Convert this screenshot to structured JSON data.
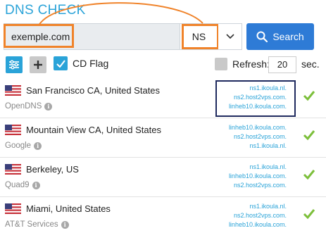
{
  "title": "DNS CHECK",
  "search": {
    "domain_value": "exemple.com",
    "record_type": "NS",
    "button_label": "Search"
  },
  "toolbar": {
    "cd_flag_label": "CD Flag",
    "cd_flag_checked": true,
    "refresh_label": "Refresh:",
    "refresh_checked": false,
    "refresh_value": "20",
    "refresh_unit": "sec."
  },
  "results": [
    {
      "location": "San Francisco CA, United States",
      "provider": "OpenDNS",
      "records": [
        "ns1.ikoula.nl.",
        "ns2.host2vps.com.",
        "linheb10.ikoula.com."
      ],
      "status": "ok"
    },
    {
      "location": "Mountain View CA, United States",
      "provider": "Google",
      "records": [
        "linheb10.ikoula.com.",
        "ns2.host2vps.com.",
        "ns1.ikoula.nl."
      ],
      "status": "ok"
    },
    {
      "location": "Berkeley, US",
      "provider": "Quad9",
      "records": [
        "ns1.ikoula.nl.",
        "linheb10.ikoula.com.",
        "ns2.host2vps.com."
      ],
      "status": "ok"
    },
    {
      "location": "Miami, United States",
      "provider": "AT&T Services",
      "records": [
        "ns1.ikoula.nl.",
        "ns2.host2vps.com.",
        "linheb10.ikoula.com."
      ],
      "status": "ok"
    }
  ],
  "colors": {
    "accent": "#2aa3d8",
    "search_button": "#2e7bd6",
    "annotation_orange": "#f0832a",
    "annotation_navy": "#1f2a5e",
    "ok_green": "#7cbf3a"
  },
  "icons": {
    "filter": "sliders-icon",
    "add": "plus-icon",
    "search": "magnifier-icon",
    "caret": "chevron-down-icon",
    "info": "info-icon",
    "status_ok": "checkmark-icon",
    "flag": "us-flag-icon"
  }
}
